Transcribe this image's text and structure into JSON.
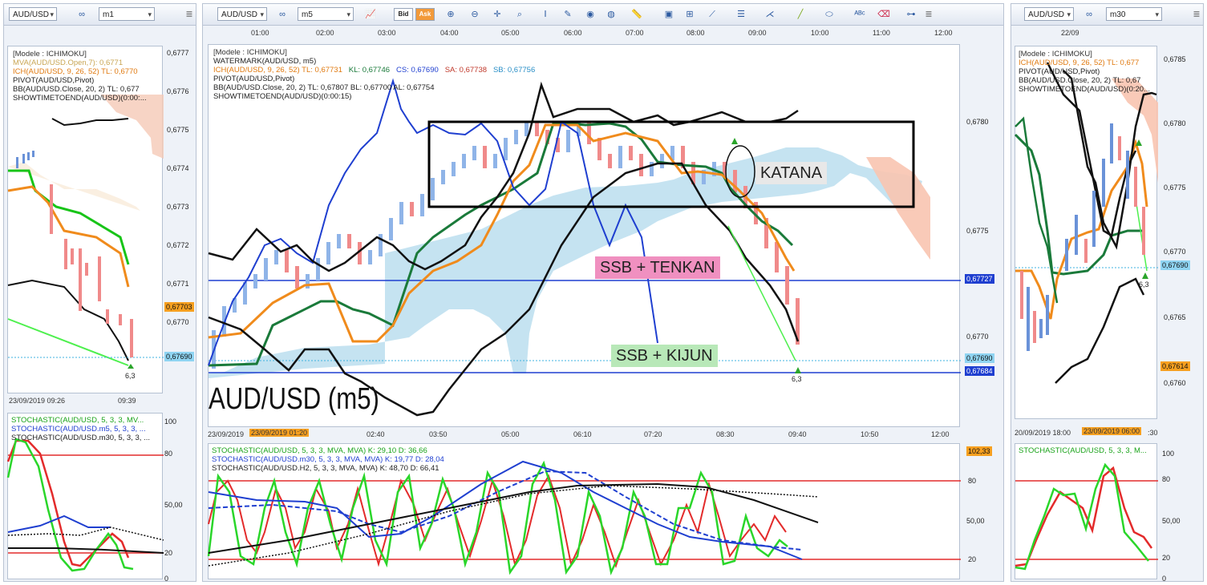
{
  "left": {
    "symbol": "AUD/USD",
    "timeframe": "m1",
    "legend": [
      "[Modele : ICHIMOKU]",
      "MVA(AUD/USD.Open,7): 0,6771",
      "ICH(AUD/USD, 9, 26, 52)  TL: 0,6770",
      "PIVOT(AUD/USD,Pivot)",
      "BB(AUD/USD.Close, 20, 2)  TL: 0,677",
      "SHOWTIMETOEND(AUD/USD)(0:00:..."
    ],
    "yticks": [
      "0,6777",
      "0,6776",
      "0,6775",
      "0,6774",
      "0,6773",
      "0,6772",
      "0,6771",
      "0,6770"
    ],
    "tag_price": "0,67703",
    "tag_current": "0,67690",
    "arrow_label": "6,3",
    "x_start": "23/09/2019 09:26",
    "x_end": "09:39",
    "stoch_legend": [
      "STOCHASTIC(AUD/USD, 5, 3, 3, MV...",
      "STOCHASTIC(AUD/USD.m5, 5, 3, 3, ...",
      "STOCHASTIC(AUD/USD.m30, 5, 3, 3, ..."
    ],
    "stoch_yticks": [
      "100",
      "80",
      "50,00",
      "20",
      "0"
    ]
  },
  "main": {
    "symbol": "AUD/USD",
    "timeframe": "m5",
    "bid_label": "Bid",
    "ask_label": "Ask",
    "top_times": [
      "01:00",
      "02:00",
      "03:00",
      "04:00",
      "05:00",
      "06:00",
      "07:00",
      "08:00",
      "09:00",
      "10:00",
      "11:00",
      "12:00"
    ],
    "legend": [
      {
        "text": "[Modele : ICHIMOKU]",
        "color": "#333333"
      },
      {
        "text": "WATERMARK(AUD/USD, m5)",
        "color": "#000000"
      },
      {
        "text": "PIVOT(AUD/USD,Pivot)",
        "color": "#000000"
      },
      {
        "text": "BB(AUD/USD.Close, 20, 2)  TL: 0,67807  BL: 0,67700  AL: 0,67754",
        "color": "#000000"
      },
      {
        "text": "SHOWTIMETOEND(AUD/USD)(0:00:15)",
        "color": "#000000"
      }
    ],
    "ich_parts": [
      {
        "text": "ICH(AUD/USD, 9, 26, 52)  TL: 0,67731",
        "color": "#e07a10"
      },
      {
        "text": "KL: 0,67746",
        "color": "#1a7a3a"
      },
      {
        "text": "CS: 0,67690",
        "color": "#1f3fd0"
      },
      {
        "text": "SA: 0,67738",
        "color": "#c0392b"
      },
      {
        "text": "SB: 0,67756",
        "color": "#2a8fc7"
      }
    ],
    "yticks": [
      "0,6780",
      "0,6775",
      "0,6770"
    ],
    "tag_level1": "0,67727",
    "tag_current": "0,67690",
    "tag_level2": "0,67684",
    "arrow_label": "6,3",
    "watermark": "AUD/USD (m5)",
    "annotations": {
      "katana": "KATANA",
      "ssb_tenkan": "SSB + TENKAN",
      "ssb_kijun": "SSB + KIJUN"
    },
    "x_first": "23/09/2019",
    "x_highlight": "23/09/2019 01:20",
    "bottom_times": [
      "02:40",
      "03:50",
      "05:00",
      "06:10",
      "07:20",
      "08:30",
      "09:40",
      "10:50",
      "12:00"
    ],
    "stoch_legend": [
      {
        "text": "STOCHASTIC(AUD/USD, 5, 3, 3, MVA, MVA)  K: 29,10  D: 36,66",
        "color": "#1aa31a"
      },
      {
        "text": "STOCHASTIC(AUD/USD.m30, 5, 3, 3, MVA, MVA)  K: 19,77  D: 28,04",
        "color": "#1f3fd0"
      },
      {
        "text": "STOCHASTIC(AUD/USD.H2, 5, 3, 3, MVA, MVA)  K: 48,70  D: 66,41",
        "color": "#000000"
      }
    ],
    "stoch_tag": "102,33",
    "stoch_yticks": [
      "80",
      "50,00",
      "20"
    ]
  },
  "right": {
    "symbol": "AUD/USD",
    "timeframe": "m30",
    "top_date": "22/09",
    "legend": [
      "[Modele : ICHIMOKU]",
      "ICH(AUD/USD, 9, 26, 52)  TL: 0,677",
      "PIVOT(AUD/USD,Pivot)",
      "BB(AUD/USD.Close, 20, 2)  TL: 0,67",
      "SHOWTIMETOEND(AUD/USD)(0:20..."
    ],
    "yticks": [
      "0,6785",
      "0,6780",
      "0,6775",
      "0,6770",
      "0,6765",
      "0,6760"
    ],
    "tag_current": "0,67690",
    "tag_price": "0,67614",
    "arrow_label": "6,3",
    "x_start": "20/09/2019 18:00",
    "x_highlight": "23/09/2019 06:00",
    "x_end": ":30",
    "stoch_legend": [
      "STOCHASTIC(AUD/USD, 5, 3, 3, M..."
    ],
    "stoch_yticks": [
      "100",
      "80",
      "50,00",
      "20",
      "0"
    ]
  },
  "colors": {
    "accent": "#f29a3a",
    "cloud": "#bfe0f0",
    "bear": "#f08a8a",
    "bull": "#8fb4e8"
  }
}
